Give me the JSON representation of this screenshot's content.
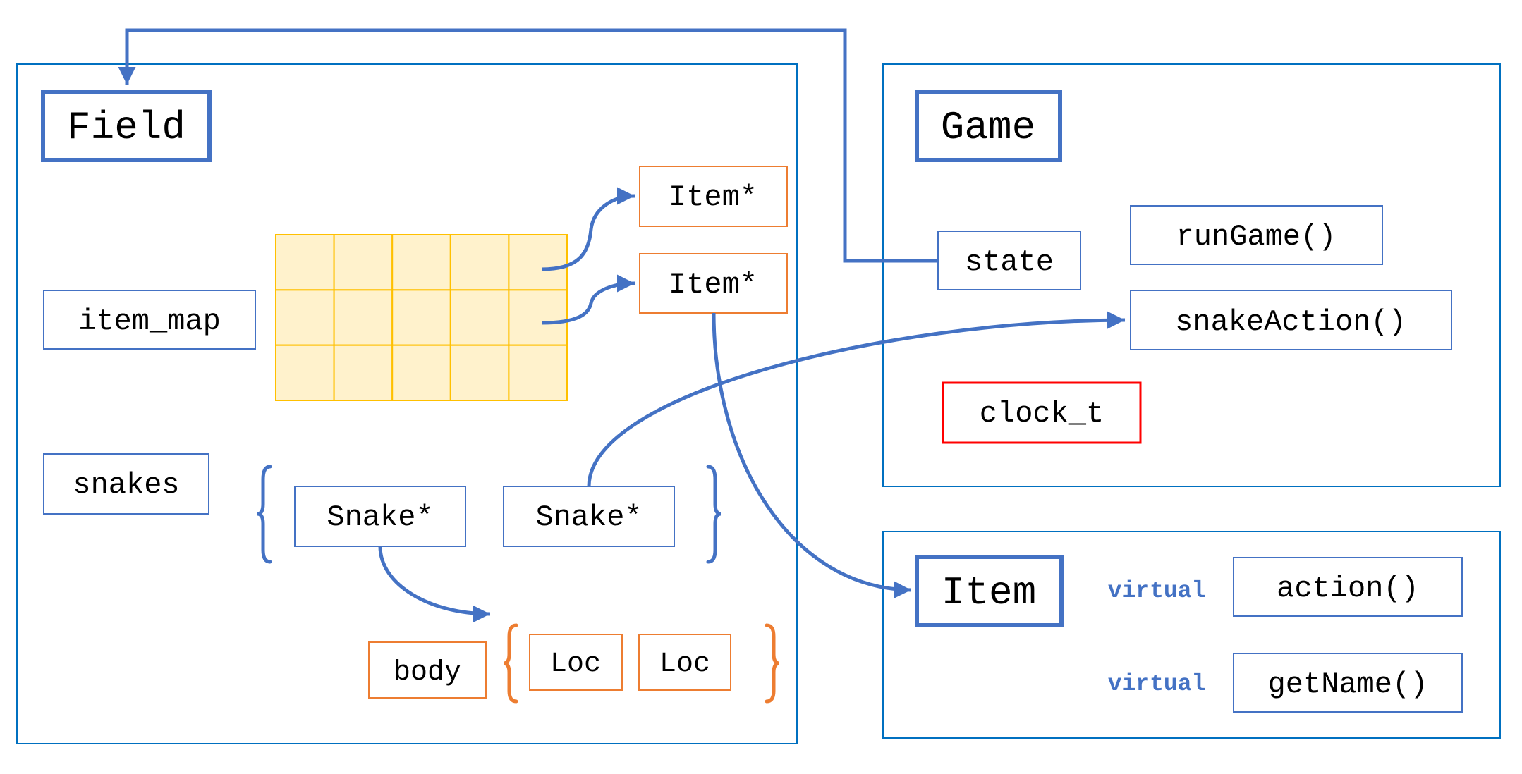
{
  "colors": {
    "blue": "#4472C4",
    "panel": "#0070C0",
    "orange": "#ED7D31",
    "grid_fill": "#FFF2CC",
    "grid_stroke": "#FFC000",
    "red": "#FF0000"
  },
  "field": {
    "title": "Field",
    "item_map": "item_map",
    "snakes": "snakes",
    "item_ptrs": [
      "Item*",
      "Item*"
    ],
    "snake_ptrs": [
      "Snake*",
      "Snake*"
    ],
    "body": "body",
    "locs": [
      "Loc",
      "Loc"
    ],
    "grid": {
      "rows": 3,
      "cols": 5
    }
  },
  "game": {
    "title": "Game",
    "state": "state",
    "methods": [
      "runGame()",
      "snakeAction()"
    ],
    "clock": "clock_t"
  },
  "item": {
    "title": "Item",
    "keyword": "virtual",
    "methods": [
      "action()",
      "getName()"
    ]
  }
}
